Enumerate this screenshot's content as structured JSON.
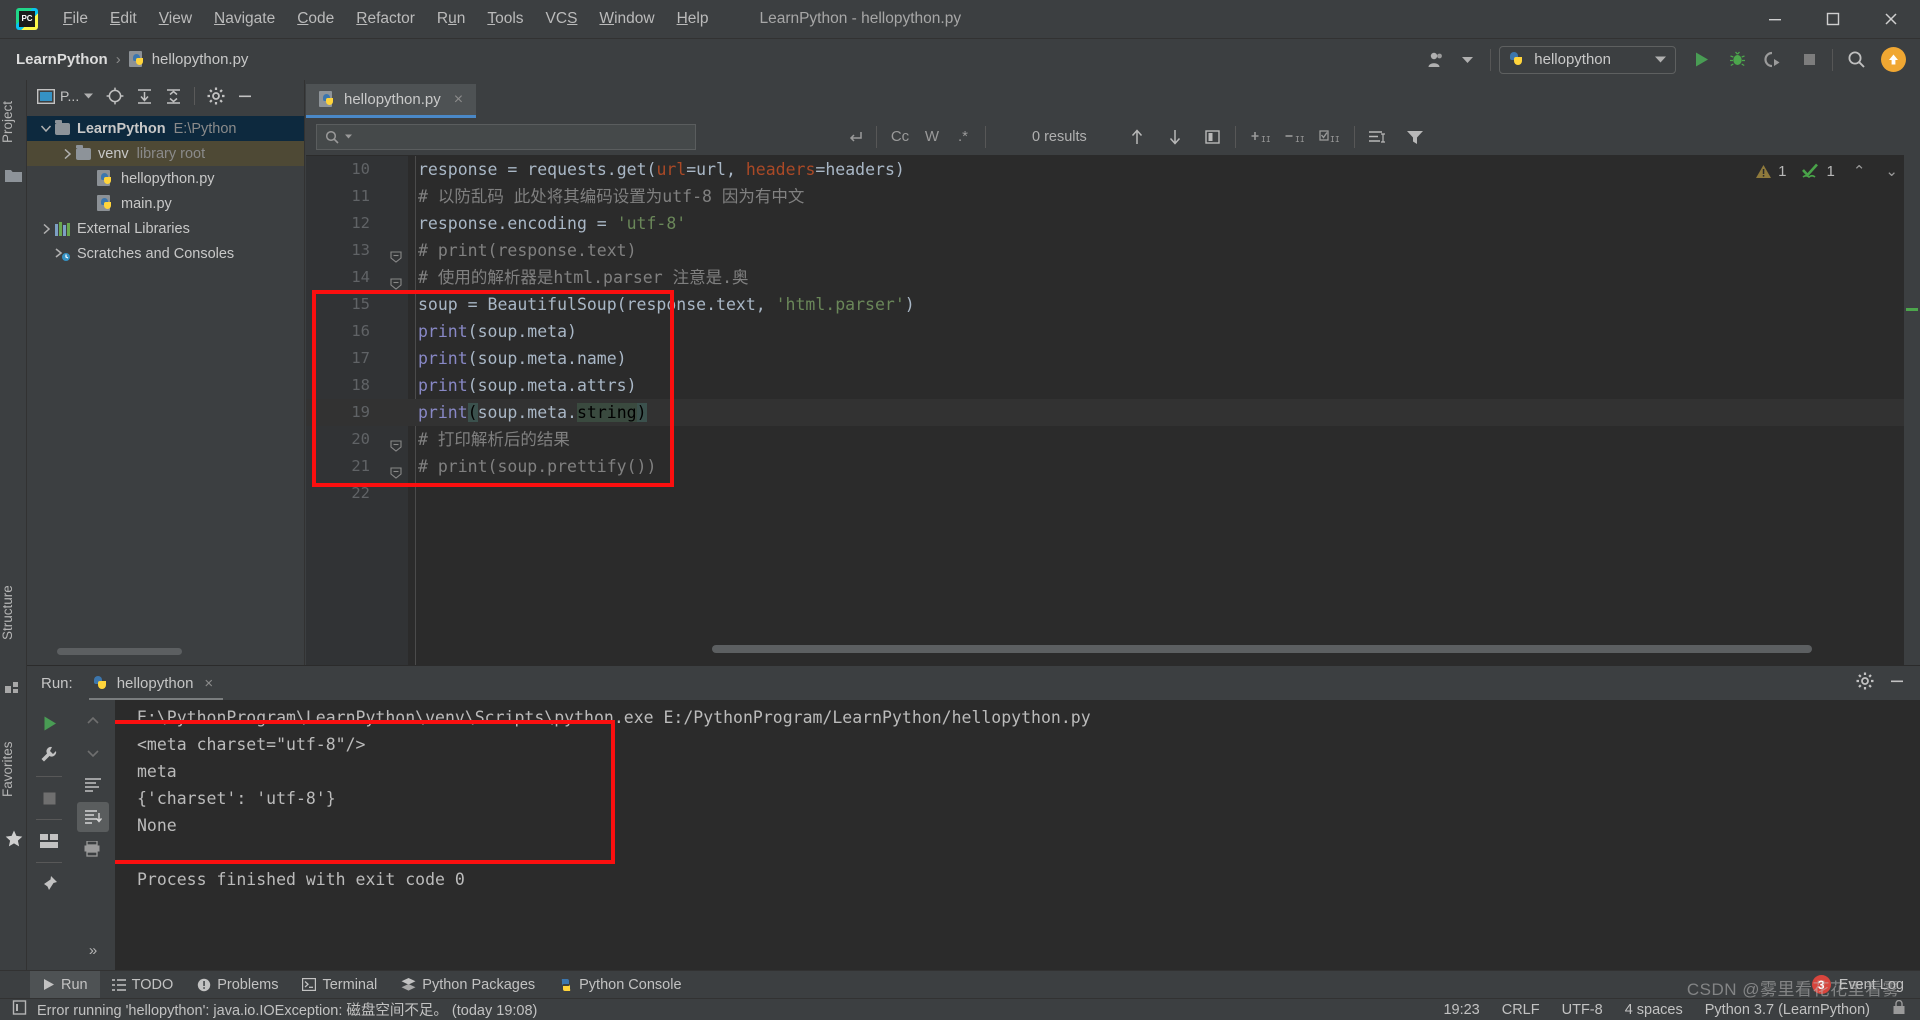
{
  "window": {
    "title": "LearnPython - hellopython.py",
    "app_icon": "pycharm-logo-icon",
    "minimize": "minimize-icon",
    "maximize": "maximize-icon",
    "close": "close-icon"
  },
  "menubar": {
    "items": [
      {
        "label": "File",
        "mnemonic": "F"
      },
      {
        "label": "Edit",
        "mnemonic": "E"
      },
      {
        "label": "View",
        "mnemonic": "V"
      },
      {
        "label": "Navigate",
        "mnemonic": "N"
      },
      {
        "label": "Code",
        "mnemonic": "C"
      },
      {
        "label": "Refactor",
        "mnemonic": "R"
      },
      {
        "label": "Run",
        "mnemonic": "u"
      },
      {
        "label": "Tools",
        "mnemonic": "T"
      },
      {
        "label": "VCS",
        "mnemonic": "S"
      },
      {
        "label": "Window",
        "mnemonic": "W"
      },
      {
        "label": "Help",
        "mnemonic": "H"
      }
    ]
  },
  "navbar": {
    "breadcrumb": [
      "LearnPython",
      "hellopython.py"
    ],
    "separator": "›",
    "run_config": "hellopython",
    "icons": {
      "user": "user-account-icon",
      "run": "run-icon",
      "debug": "debug-icon",
      "coverage": "run-with-coverage-icon",
      "stop": "stop-icon",
      "search": "search-everywhere-icon",
      "update": "update-project-icon"
    }
  },
  "left_rail": {
    "project_label": "Project",
    "structure_label": "Structure",
    "favorites_label": "Favorites"
  },
  "project_panel": {
    "toolbar": {
      "scope": "P...",
      "locate": "locate-icon",
      "expand_all": "expand-all-icon",
      "collapse_all": "collapse-all-icon",
      "settings": "gear-icon",
      "hide": "hide-icon"
    },
    "tree": [
      {
        "label": "LearnPython",
        "suffix": "E:\\Python",
        "kind": "project-root",
        "expanded": true,
        "indent": 0,
        "selected": "blue"
      },
      {
        "label": "venv",
        "suffix": "library root",
        "kind": "folder",
        "expanded": false,
        "indent": 1,
        "selected": "tan"
      },
      {
        "label": "hellopython.py",
        "suffix": "",
        "kind": "python-file",
        "indent": 2,
        "selected": ""
      },
      {
        "label": "main.py",
        "suffix": "",
        "kind": "python-file",
        "indent": 2,
        "selected": ""
      },
      {
        "label": "External Libraries",
        "suffix": "",
        "kind": "libraries",
        "expanded": false,
        "indent": 0,
        "selected": ""
      },
      {
        "label": "Scratches and Consoles",
        "suffix": "",
        "kind": "scratches",
        "indent": 0,
        "selected": ""
      }
    ]
  },
  "editor": {
    "tab": {
      "label": "hellopython.py",
      "close": "×",
      "icon": "python-file-icon"
    },
    "findbar": {
      "placeholder": "",
      "results": "0 results",
      "toggles": [
        "Cc",
        "W",
        ".*"
      ],
      "icons": {
        "search": "search-icon",
        "regex_history": "search-history-icon",
        "prev": "find-previous-icon",
        "next": "find-next-icon",
        "select_all": "select-all-occurrences-icon",
        "add_line_before": "add-line-before-icon",
        "remove_line": "remove-line-icon",
        "toggle_lines": "toggle-lines-icon",
        "scope": "scope-icon",
        "filter": "filter-icon"
      }
    },
    "inspections": {
      "warning_count": "1",
      "check_count": "1",
      "up": "⌃",
      "down": "⌄"
    },
    "first_line_number": 10,
    "lines": [
      {
        "n": 10,
        "tokens": [
          {
            "t": "response ",
            "c": "txt-def"
          },
          {
            "t": "= ",
            "c": "txt-def"
          },
          {
            "t": "requests",
            "c": "txt-def"
          },
          {
            "t": ".get(",
            "c": "txt-def"
          },
          {
            "t": "url",
            "c": "param"
          },
          {
            "t": "=url, ",
            "c": "txt-def"
          },
          {
            "t": "headers",
            "c": "param"
          },
          {
            "t": "=headers)",
            "c": "txt-def"
          }
        ]
      },
      {
        "n": 11,
        "tokens": [
          {
            "t": "# 以防乱码 此处将其编码设置为utf-8 因为有中文",
            "c": "com"
          }
        ]
      },
      {
        "n": 12,
        "tokens": [
          {
            "t": "response.encoding = ",
            "c": "txt-def"
          },
          {
            "t": "'utf-8'",
            "c": "str"
          }
        ]
      },
      {
        "n": 13,
        "fold": true,
        "tokens": [
          {
            "t": "# print(response.text)",
            "c": "com"
          }
        ]
      },
      {
        "n": 14,
        "fold": true,
        "tokens": [
          {
            "t": "# 使用的解析器是html.parser 注意是.奥",
            "c": "com"
          }
        ]
      },
      {
        "n": 15,
        "tokens": [
          {
            "t": "soup = BeautifulSoup(response.text, ",
            "c": "txt-def"
          },
          {
            "t": "'html.parser'",
            "c": "str"
          },
          {
            "t": ")",
            "c": "txt-def"
          }
        ]
      },
      {
        "n": 16,
        "tokens": [
          {
            "t": "print",
            "c": "call"
          },
          {
            "t": "(soup.meta)",
            "c": "txt-def"
          }
        ]
      },
      {
        "n": 17,
        "tokens": [
          {
            "t": "print",
            "c": "call"
          },
          {
            "t": "(soup.meta.name)",
            "c": "txt-def"
          }
        ]
      },
      {
        "n": 18,
        "tokens": [
          {
            "t": "print",
            "c": "call"
          },
          {
            "t": "(soup.meta.attrs)",
            "c": "txt-def"
          }
        ]
      },
      {
        "n": 19,
        "current": true,
        "tokens": [
          {
            "t": "print",
            "c": "call"
          },
          {
            "t": "(",
            "c": "brace-hl"
          },
          {
            "t": "soup.meta.",
            "c": "txt-def"
          },
          {
            "t": "string",
            "c": "sel-hl"
          },
          {
            "t": ")",
            "c": "brace-hl"
          }
        ]
      },
      {
        "n": 20,
        "fold": true,
        "tokens": [
          {
            "t": "# 打印解析后的结果",
            "c": "com"
          }
        ]
      },
      {
        "n": 21,
        "fold": true,
        "tokens": [
          {
            "t": "# print(soup.prettify())",
            "c": "com"
          }
        ]
      },
      {
        "n": 22,
        "tokens": []
      }
    ]
  },
  "run_panel": {
    "label": "Run:",
    "tab": "hellopython",
    "tab_close": "×",
    "sidebar_icons": [
      "rerun-icon",
      "wrench-icon",
      "stop-icon",
      "layout-icon",
      "pin-icon",
      "up-icon",
      "down-icon",
      "soft-wrap-icon",
      "scroll-to-end-icon",
      "print-icon",
      "more-icon"
    ],
    "header_icons": [
      "gear-icon",
      "hide-icon"
    ],
    "console_lines": [
      "E:\\PythonProgram\\LearnPython\\venv\\Scripts\\python.exe E:/PythonProgram/LearnPython/hellopython.py",
      "<meta charset=\"utf-8\"/>",
      "meta",
      "{'charset': 'utf-8'}",
      "None",
      "",
      "Process finished with exit code 0"
    ]
  },
  "tool_strip": {
    "items": [
      {
        "label": "Run",
        "icon": "run-icon",
        "active": true
      },
      {
        "label": "TODO",
        "icon": "todo-icon",
        "active": false
      },
      {
        "label": "Problems",
        "icon": "problems-icon",
        "active": false
      },
      {
        "label": "Terminal",
        "icon": "terminal-icon",
        "active": false
      },
      {
        "label": "Python Packages",
        "icon": "packages-icon",
        "active": false
      },
      {
        "label": "Python Console",
        "icon": "python-console-icon",
        "active": false
      }
    ],
    "event_log": {
      "label": "Event Log",
      "count": "3"
    }
  },
  "status_bar": {
    "message": "Error running 'hellopython': java.io.IOException: 磁盘空间不足。 (today 19:08)",
    "message_icon": "notification-icon",
    "time": "19:23",
    "line_separator": "CRLF",
    "encoding": "UTF-8",
    "indent": "4 spaces",
    "interpreter": "Python 3.7 (LearnPython)",
    "lock_icon": "lock-icon"
  },
  "watermark": "CSDN @雾里看花花里看雾",
  "colors": {
    "bg_chrome": "#3c3f41",
    "bg_editor": "#2b2b2b",
    "gutter": "#313335",
    "accent_blue": "#4a88c7",
    "highlight_red": "#fb0f0f",
    "selection_blue": "#0d293e",
    "selection_tan": "#4e4935",
    "run_green": "#499c54",
    "orange": "#f0a732"
  }
}
